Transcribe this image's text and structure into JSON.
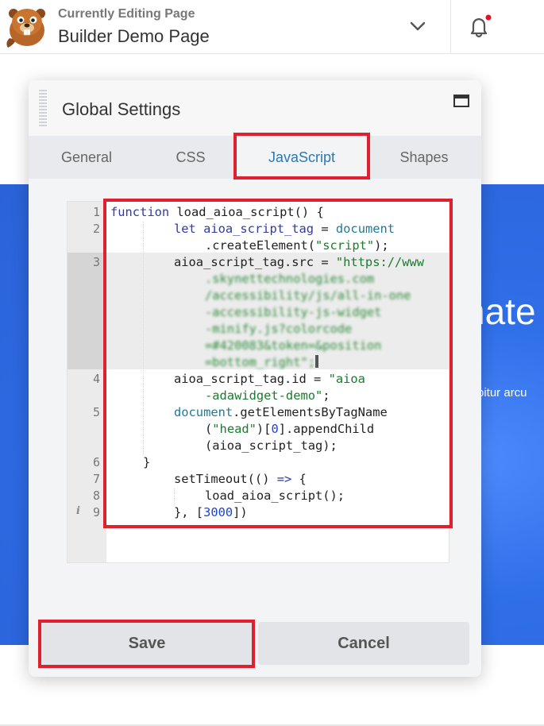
{
  "topbar": {
    "subtitle": "Currently Editing Page",
    "title": "Builder Demo Page"
  },
  "background": {
    "heading_fragment": "nate",
    "text_fragment": "bitur arcu"
  },
  "modal": {
    "title": "Global Settings",
    "tabs": [
      {
        "label": "General",
        "active": false
      },
      {
        "label": "CSS",
        "active": false
      },
      {
        "label": "JavaScript",
        "active": true
      },
      {
        "label": "Shapes",
        "active": false
      }
    ],
    "editor": {
      "language": "javascript",
      "line_numbers": [
        "1",
        "2",
        "3",
        "4",
        "5",
        "6",
        "7",
        "8",
        "9"
      ],
      "code": {
        "l1_kw": "function",
        "l1_rest": " load_aioa_script() {",
        "l2_kw": "let",
        "l2_var": " aioa_script_tag",
        "l2_eq": " = ",
        "l2_global": "document",
        "l2b_pre": ".createElement(",
        "l2b_str": "\"script\"",
        "l2b_post": ");",
        "l3_pre": "aioa_script_tag.src = ",
        "l3_str": "\"https://www",
        "l3_blur": [
          ".skynettechnologies.com",
          "/accessibility/js/all-in-one",
          "-accessibility-js-widget",
          "-minify.js?colorcode",
          "=#420083&token=&position",
          "=bottom_right\";"
        ],
        "l4_pre": "aioa_script_tag.id = ",
        "l4_str": "\"aioa",
        "l4b_str": "-adawidget-demo\"",
        "l4b_post": ";",
        "l5_global": "document",
        "l5_rest": ".getElementsByTagName",
        "l5b_pre": "(",
        "l5b_str": "\"head\"",
        "l5b_mid": ")[",
        "l5b_num": "0",
        "l5b_post": "].appendChild",
        "l5c": "(aioa_script_tag);",
        "l6": "}",
        "l7_pre": "setTimeout(() ",
        "l7_arrow": "=>",
        "l7_post": " {",
        "l8": "load_aioa_script();",
        "l9_pre": "}, [",
        "l9_num": "3000",
        "l9_post": "])"
      }
    },
    "buttons": {
      "save": "Save",
      "cancel": "Cancel"
    }
  },
  "colors": {
    "annotation_red": "#e0202e",
    "active_tab_text": "#2c78b5",
    "hero_blue": "#2f6fe8",
    "notification_dot": "#e3101f"
  },
  "icons": [
    "beaver-logo-icon",
    "chevron-down-icon",
    "bell-icon",
    "maximize-icon",
    "drag-handle-icon",
    "info-icon"
  ]
}
